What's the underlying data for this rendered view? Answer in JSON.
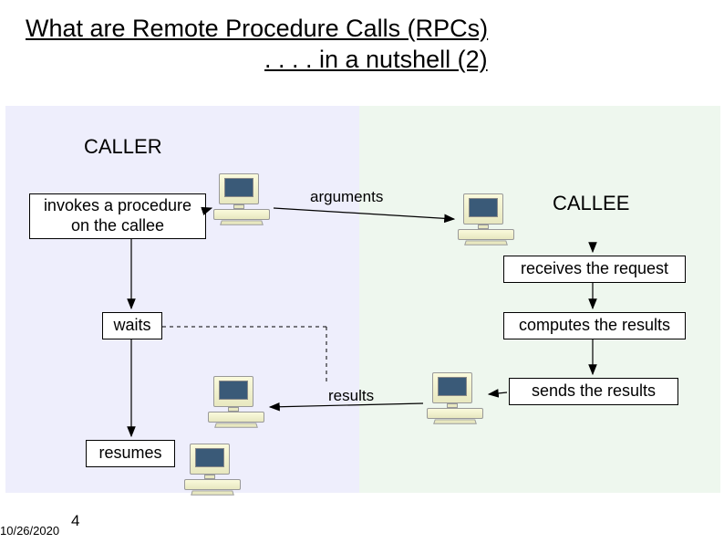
{
  "title": "What are Remote Procedure Calls (RPCs)",
  "subtitle": ". . . . in a nutshell (2)",
  "caller_label": "CALLER",
  "callee_label": "CALLEE",
  "box_invokes": "invokes a procedure on the callee",
  "box_waits": "waits",
  "box_resumes": "resumes",
  "box_receives": "receives the request",
  "box_computes": "computes the results",
  "box_sends": "sends the results",
  "arrow_arguments": "arguments",
  "arrow_results": "results",
  "slide_number": "4",
  "slide_date": "10/26/2020"
}
